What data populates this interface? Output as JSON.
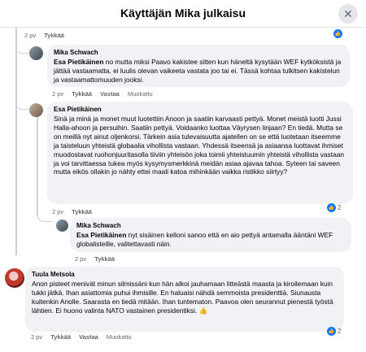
{
  "header": {
    "title": "Käyttäjän Mika julkaisu",
    "close_glyph": "✕"
  },
  "top_meta": {
    "time": "2 pv",
    "like": "Tykkää"
  },
  "comments": [
    {
      "author": "Mika Schwach",
      "mention": "Esa Pietikäinen",
      "text": " no mutta miksi Paavo kakistee sitten kun häneltä kysytään WEF kytköksistä ja jättää vastaamatta, ei luulis olevan vaikeeta vastata joo tai ei. Tässä kohtaa tulkitsen kakistelun ja vastaamattomuuden jooksi.",
      "time": "2 pv",
      "like": "Tykkää",
      "reply": "Vastaa",
      "edited": "Muokattu"
    },
    {
      "author": "Esa Pietikäinen",
      "text": "Sinä ja minä ja monet muut luotettiin Anoon ja saatiin karvaasti pettyä. Monet meistä luotti Jussi Halla-ahoon ja persuihin. Saatiin pettyä. Voidaanko luottaa Väyrysen linjaan? En tiedä. Mutta se on meillä nyt ainut oljenkorsi. Tärkein asia tulevaisuutta ajatellen on se että luotetaan itseemme ja taisteluun yhteistä globaalia vihollista vastaan. Yhdessä itseensä ja asiaansa luottavat ihmiset muodostavat ruohonjuuritasolla tiiviin yhteisön joka toimii yhteistuumin yhteistä vihollista vastaan ja voi tarvittaessa tukea myös kysymysmerkkinä meidän asiaa ajavaa tahoa. Syteen tai saveen mutta eikös ollakin jo nähty ettei maali katoa mihinkään vaikka ristikko siirtyy?",
      "time": "2 pv",
      "like": "Tykkää",
      "reaction_count": "2"
    },
    {
      "author": "Mika Schwach",
      "mention": "Esa Pietikäinen",
      "text": " nyt sisäinen kelloni sanoo että en aio pettyä antamalla ääntäni WEF globalisteille, valitettavasti näin.",
      "time": "2 pv",
      "like": "Tykkää"
    },
    {
      "author": "Tuula Metsola",
      "text": "Anon pisteet menivät minun silmissäni kun hän alkoi jauhamaan litteästä maasta ja kiroilemaan kuin tukki jätkä. Ihan asiattomia puhui ihmisille. En haluaisi nähdä semmoista presidenttiä. Siunausta kuitenkin Anolle. Saarasta en tiedä mitään. Ihan tuntematon. Paavoa olen seurannut pienestä työstä lähtien. Ei huono valinta NATO vastainen presidentiksi. 👍",
      "time": "2 pv",
      "like": "Tykkää",
      "reply": "Vastaa",
      "edited": "Muokattu",
      "reaction_count": "2"
    }
  ],
  "colors": {
    "like_blue": "#1877f2",
    "bubble_bg": "#f0f2f5",
    "meta_grey": "#65676b"
  },
  "icons": {
    "like": "thumbs-up-icon",
    "close": "close-icon"
  }
}
